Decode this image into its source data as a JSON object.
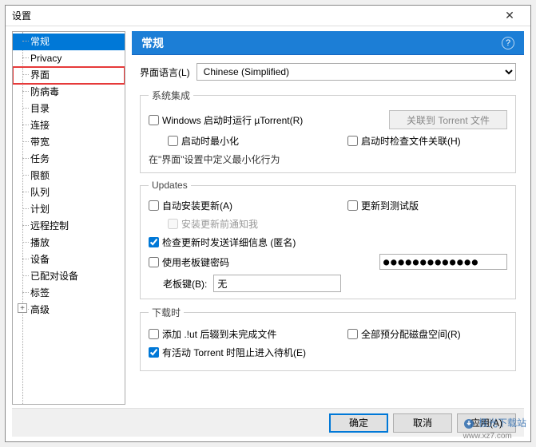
{
  "window": {
    "title": "设置",
    "close": "✕"
  },
  "sidebar": {
    "items": [
      {
        "label": "常规",
        "selected": true
      },
      {
        "label": "Privacy"
      },
      {
        "label": "界面",
        "highlighted": true
      },
      {
        "label": "防病毒"
      },
      {
        "label": "目录"
      },
      {
        "label": "连接"
      },
      {
        "label": "带宽"
      },
      {
        "label": "任务"
      },
      {
        "label": "限额"
      },
      {
        "label": "队列"
      },
      {
        "label": "计划"
      },
      {
        "label": "远程控制"
      },
      {
        "label": "播放"
      },
      {
        "label": "设备"
      },
      {
        "label": "已配对设备"
      },
      {
        "label": "标签"
      },
      {
        "label": "高级",
        "expandable": true
      }
    ]
  },
  "header": {
    "title": "常规",
    "help": "?"
  },
  "lang": {
    "label": "界面语言(L)",
    "value": "Chinese (Simplified)"
  },
  "sysint": {
    "legend": "系统集成",
    "run_startup": "Windows 启动时运行 µTorrent(R)",
    "assoc_btn": "关联到 Torrent 文件",
    "minimize_start": "启动时最小化",
    "check_assoc": "启动时检查文件关联(H)",
    "note": "在\"界面\"设置中定义最小化行为"
  },
  "updates": {
    "legend": "Updates",
    "auto_install": "自动安装更新(A)",
    "beta": "更新到测试版",
    "notify": "安装更新前通知我",
    "send_details": "检查更新时发送详细信息 (匿名)",
    "use_bosskey_pw": "使用老板键密码",
    "pw_value": "●●●●●●●●●●●●●",
    "bosskey_label": "老板键(B):",
    "bosskey_value": "无"
  },
  "download": {
    "legend": "下载时",
    "append_ut": "添加 .!ut 后辍到未完成文件",
    "prealloc": "全部预分配磁盘空间(R)",
    "prevent_standby": "有活动 Torrent 时阻止进入待机(E)"
  },
  "footer": {
    "ok": "确定",
    "cancel": "取消",
    "apply": "应用(A)"
  },
  "watermark": {
    "text": "极光下载站",
    "url": "www.xz7.com"
  }
}
